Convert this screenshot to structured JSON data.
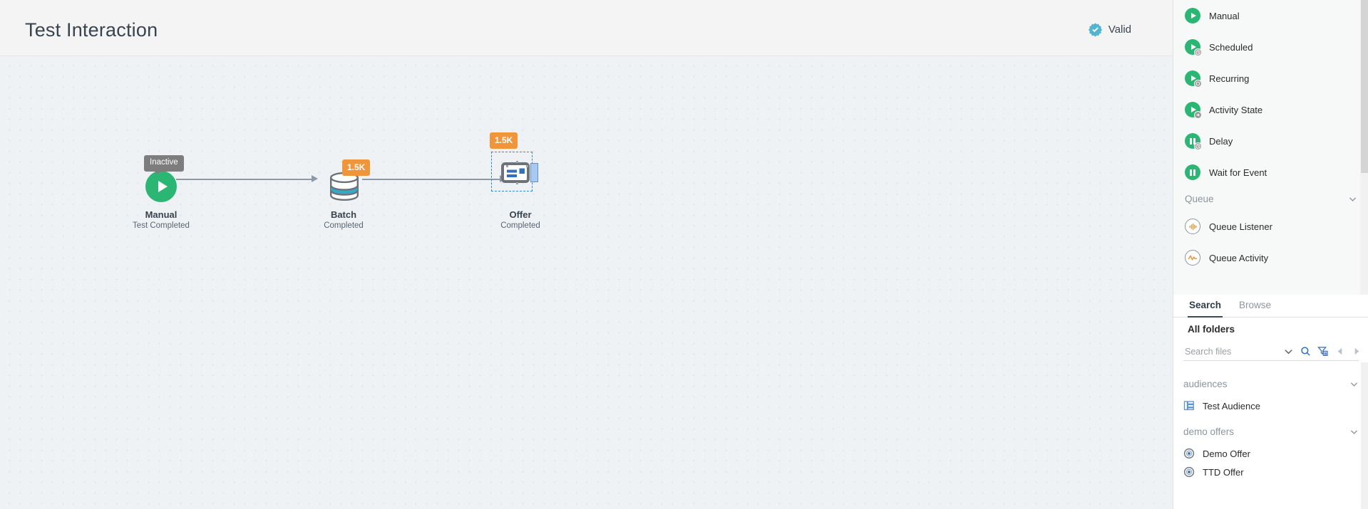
{
  "header": {
    "title": "Test Interaction",
    "status_label": "Valid",
    "status_icon": "verified-seal-icon",
    "status_color": "#53b4d0"
  },
  "canvas": {
    "background_color": "#eef2f5",
    "nodes": [
      {
        "id": "manual",
        "name": "Manual",
        "subtitle": "Test Completed",
        "tooltip": "Inactive",
        "icon": "play-circle-icon",
        "icon_color": "#2bb673"
      },
      {
        "id": "batch",
        "name": "Batch",
        "subtitle": "Completed",
        "badge": "1.5K",
        "badge_color": "#f0963a",
        "icon": "database-cylinder-icon"
      },
      {
        "id": "offer",
        "name": "Offer",
        "subtitle": "Completed",
        "badge": "1.5K",
        "badge_color": "#f0963a",
        "icon": "offer-card-icon",
        "selected": true
      }
    ]
  },
  "sidebar": {
    "palette": {
      "activities": [
        {
          "label": "Manual",
          "icon": "play-circle-icon",
          "badge_icon": "none"
        },
        {
          "label": "Scheduled",
          "icon": "play-circle-icon",
          "badge_icon": "clock-icon"
        },
        {
          "label": "Recurring",
          "icon": "play-circle-icon",
          "badge_icon": "recurring-icon"
        },
        {
          "label": "Activity State",
          "icon": "play-circle-icon",
          "badge_icon": "arrow-right-icon"
        },
        {
          "label": "Delay",
          "icon": "pause-circle-icon",
          "badge_icon": "clock-icon"
        },
        {
          "label": "Wait for Event",
          "icon": "pause-circle-icon",
          "badge_icon": "none"
        }
      ],
      "queue_group": {
        "label": "Queue",
        "chevron": "chevron-down-icon",
        "items": [
          {
            "label": "Queue Listener",
            "icon": "queue-listener-icon"
          },
          {
            "label": "Queue Activity",
            "icon": "queue-activity-icon"
          }
        ]
      }
    },
    "tabs": [
      {
        "id": "search",
        "label": "Search",
        "active": true
      },
      {
        "id": "browse",
        "label": "Browse",
        "active": false
      }
    ],
    "folders_heading": "All folders",
    "search": {
      "placeholder": "Search files",
      "value": "",
      "tools": [
        "chevron-down-icon",
        "search-icon",
        "filter-icon",
        "prev-arrow-icon",
        "next-arrow-icon"
      ]
    },
    "results": [
      {
        "group": "audiences",
        "chevron": "chevron-down-icon",
        "items": [
          {
            "label": "Test Audience",
            "icon": "audience-icon"
          }
        ]
      },
      {
        "group": "demo offers",
        "chevron": "chevron-down-icon",
        "items": [
          {
            "label": "Demo Offer",
            "icon": "offer-target-icon"
          },
          {
            "label": "TTD Offer",
            "icon": "offer-target-icon"
          }
        ]
      }
    ]
  }
}
